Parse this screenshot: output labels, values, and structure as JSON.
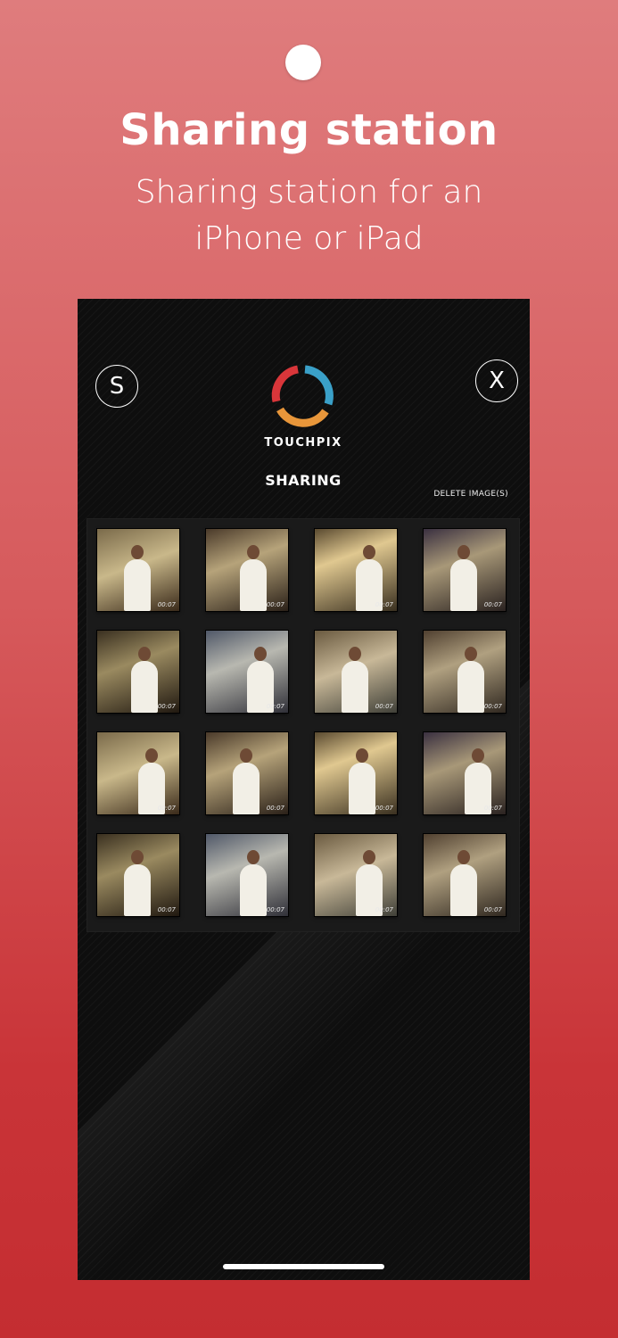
{
  "header": {
    "title": "Sharing station",
    "subtitle_line1": "Sharing station for an",
    "subtitle_line2": "iPhone or iPad"
  },
  "app": {
    "left_button": "S",
    "close_button": "X",
    "logo_text": "TOUCHPIX",
    "screen_title": "SHARING",
    "delete_label": "DELETE IMAGE(S)",
    "thumbnails": [
      {
        "duration": "00:07"
      },
      {
        "duration": "00:07"
      },
      {
        "duration": "00:07"
      },
      {
        "duration": "00:07"
      },
      {
        "duration": "00:07"
      },
      {
        "duration": "00:07"
      },
      {
        "duration": "00:07"
      },
      {
        "duration": "00:07"
      },
      {
        "duration": "00:07"
      },
      {
        "duration": "00:07"
      },
      {
        "duration": "00:07"
      },
      {
        "duration": "00:07"
      },
      {
        "duration": "00:07"
      },
      {
        "duration": "00:07"
      },
      {
        "duration": "00:07"
      },
      {
        "duration": "00:07"
      }
    ]
  },
  "colors": {
    "logo_red": "#d9363a",
    "logo_blue": "#3aa0c8",
    "logo_orange": "#e8963a"
  }
}
